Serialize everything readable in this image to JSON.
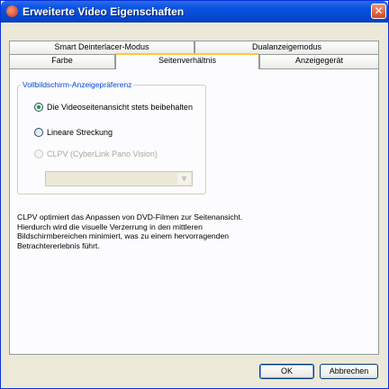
{
  "window": {
    "title": "Erweiterte Video Eigenschaften",
    "close_glyph": "✕"
  },
  "tabs": {
    "row_back": [
      {
        "label": "Smart Deinterlacer-Modus"
      },
      {
        "label": "Dualanzeigemodus"
      }
    ],
    "row_front": [
      {
        "label": "Farbe"
      },
      {
        "label": "Seitenverhältnis",
        "active": true
      },
      {
        "label": "Anzeigegerät"
      }
    ]
  },
  "group": {
    "legend": "Vollbildschirm-Anzeigepräferenz",
    "options": [
      {
        "label": "Die Videoseitenansicht stets beibehalten",
        "checked": true,
        "enabled": true
      },
      {
        "label": "Lineare Streckung",
        "checked": false,
        "enabled": true
      },
      {
        "label": "CLPV (CyberLink Pano Vision)",
        "checked": false,
        "enabled": false
      }
    ],
    "combo": {
      "value": "",
      "enabled": false
    }
  },
  "description": [
    "CLPV optimiert das Anpassen von DVD-Filmen zur Seitenansicht.",
    "Hierdurch wird die visuelle Verzerrung in den mittleren",
    "Bildschirmbereichen minimiert, was zu einem hervorragenden",
    "Betrachtererlebnis führt."
  ],
  "buttons": {
    "ok": "OK",
    "cancel": "Abbrechen"
  },
  "icons": {
    "title_icon": "cyberlink-app-icon",
    "close": "close-icon",
    "combo_arrow": "chevron-down-icon"
  }
}
